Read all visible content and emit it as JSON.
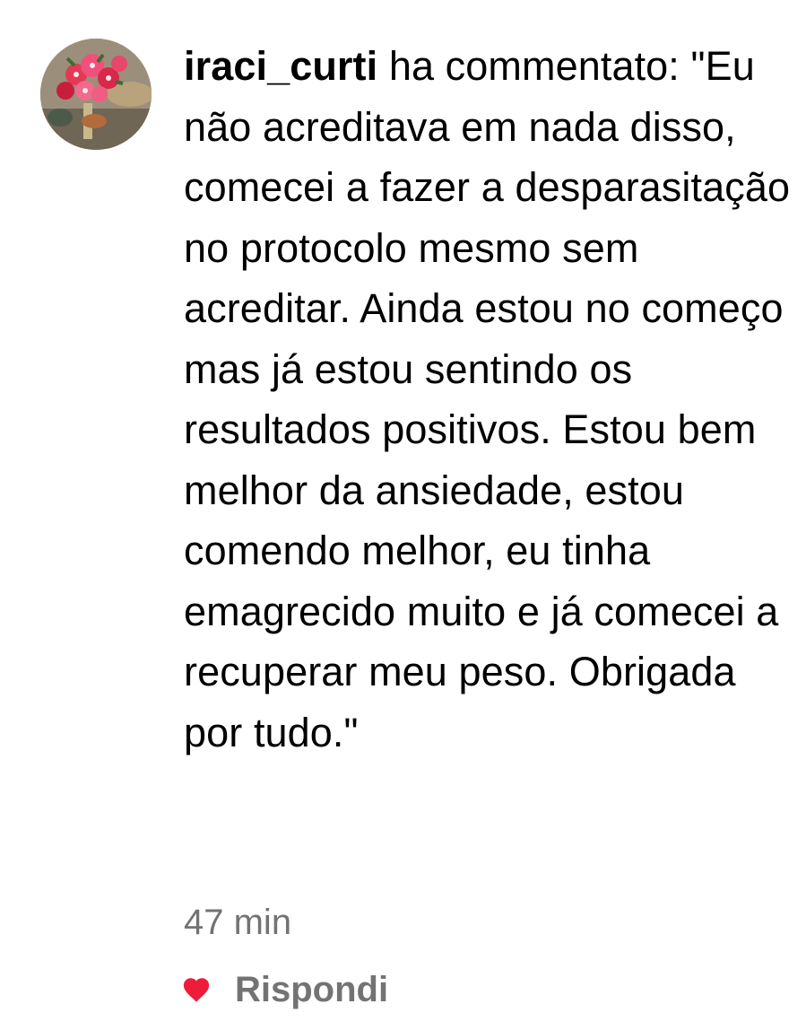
{
  "comment": {
    "username": "iraci_curti",
    "action_text": "ha commentato:",
    "body": "\"Eu não acreditava em nada disso, comecei a fazer a desparasitação no protocolo mesmo sem acreditar.  Ainda estou no começo mas já estou sentindo os resultados positivos. Estou bem melhor da ansiedade, estou comendo melhor, eu tinha emagrecido muito e já comecei a recuperar meu peso. Obrigada por tudo.\"",
    "timestamp": "47 min",
    "like_icon": "heart-icon",
    "reply_label": "Rispondi"
  },
  "colors": {
    "text": "#000000",
    "secondary": "#737373",
    "heart": "#ed1c3b"
  }
}
